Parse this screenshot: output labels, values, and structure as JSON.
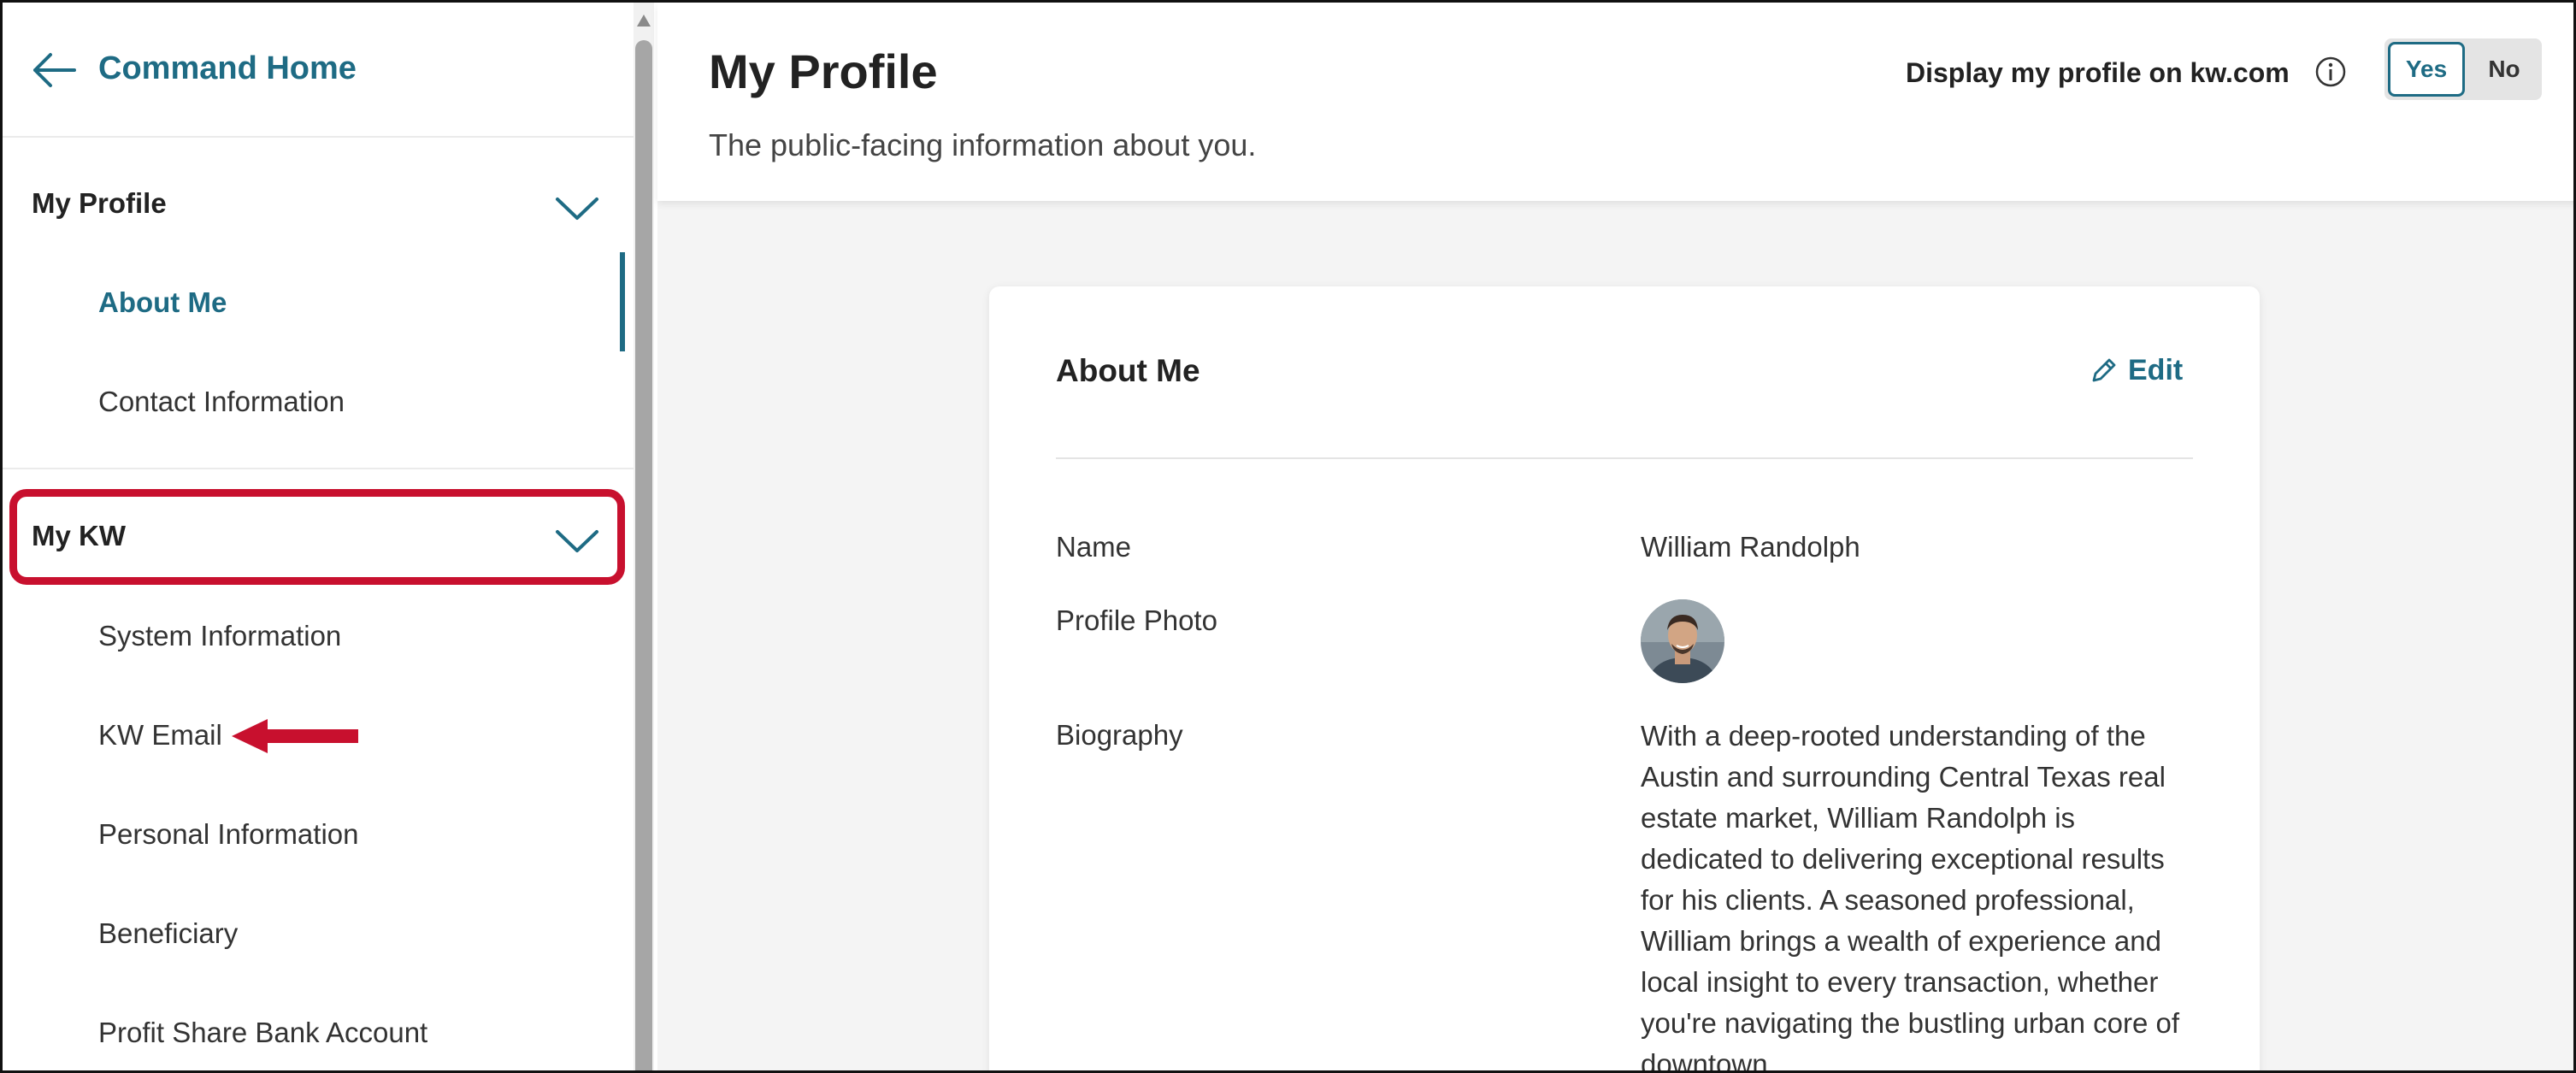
{
  "sidebar": {
    "back_label": "Command Home",
    "sections": [
      {
        "label": "My Profile",
        "items": [
          "About Me",
          "Contact Information"
        ]
      },
      {
        "label": "My KW",
        "items": [
          "System Information",
          "KW Email",
          "Personal Information",
          "Beneficiary",
          "Profit Share Bank Account"
        ]
      }
    ],
    "active_item": "About Me"
  },
  "header": {
    "title": "My Profile",
    "subtitle": "The public-facing information about you.",
    "display_label": "Display my profile on kw.com",
    "toggle_yes": "Yes",
    "toggle_no": "No",
    "toggle_selected": "Yes"
  },
  "card": {
    "title": "About Me",
    "edit_label": "Edit",
    "fields": {
      "name_label": "Name",
      "name_value": "William Randolph",
      "photo_label": "Profile Photo",
      "bio_label": "Biography",
      "bio_value": "With a deep-rooted understanding of the Austin and surrounding Central Texas real estate market, William Randolph is dedicated to delivering exceptional results for his clients. A seasoned professional, William brings a wealth of experience and local insight to every transaction, whether you're navigating the bustling urban core of downtown"
    }
  },
  "colors": {
    "accent": "#1e6b84",
    "highlight": "#c8102e",
    "background": "#f4f4f4"
  }
}
